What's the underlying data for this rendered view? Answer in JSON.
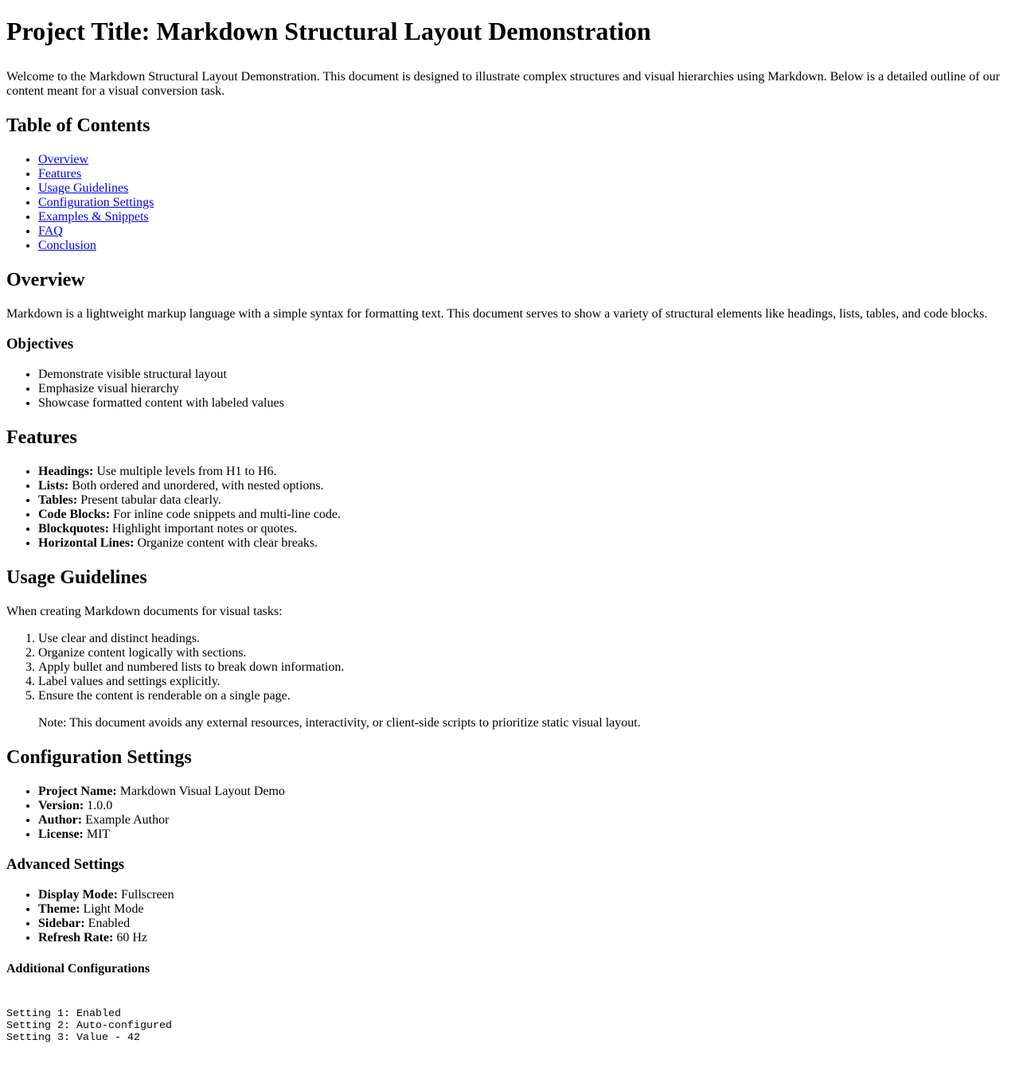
{
  "title": "Project Title: Markdown Structural Layout Demonstration",
  "intro": "Welcome to the Markdown Structural Layout Demonstration. This document is designed to illustrate complex structures and visual hierarchies using Markdown. Below is a detailed outline of our content meant for a visual conversion task.",
  "toc": {
    "heading": "Table of Contents",
    "items": [
      "Overview",
      "Features",
      "Usage Guidelines",
      "Configuration Settings",
      "Examples & Snippets",
      "FAQ",
      "Conclusion"
    ]
  },
  "overview": {
    "heading": "Overview",
    "text": "Markdown is a lightweight markup language with a simple syntax for formatting text. This document serves to show a variety of structural elements like headings, lists, tables, and code blocks.",
    "objectives_heading": "Objectives",
    "objectives": [
      "Demonstrate visible structural layout",
      "Emphasize visual hierarchy",
      "Showcase formatted content with labeled values"
    ]
  },
  "features": {
    "heading": "Features",
    "items": [
      {
        "label": "Headings:",
        "text": " Use multiple levels from H1 to H6."
      },
      {
        "label": "Lists:",
        "text": " Both ordered and unordered, with nested options."
      },
      {
        "label": "Tables:",
        "text": " Present tabular data clearly."
      },
      {
        "label": "Code Blocks:",
        "text": " For inline code snippets and multi-line code."
      },
      {
        "label": "Blockquotes:",
        "text": " Highlight important notes or quotes."
      },
      {
        "label": "Horizontal Lines:",
        "text": " Organize content with clear breaks."
      }
    ]
  },
  "usage": {
    "heading": "Usage Guidelines",
    "intro": "When creating Markdown documents for visual tasks:",
    "steps": [
      "Use clear and distinct headings.",
      "Organize content logically with sections.",
      "Apply bullet and numbered lists to break down information.",
      "Label values and settings explicitly.",
      "Ensure the content is renderable on a single page."
    ],
    "note": "Note: This document avoids any external resources, interactivity, or client-side scripts to prioritize static visual layout."
  },
  "config": {
    "heading": "Configuration Settings",
    "items": [
      {
        "label": "Project Name:",
        "text": " Markdown Visual Layout Demo"
      },
      {
        "label": "Version:",
        "text": " 1.0.0"
      },
      {
        "label": "Author:",
        "text": " Example Author"
      },
      {
        "label": "License:",
        "text": " MIT"
      }
    ],
    "advanced_heading": "Advanced Settings",
    "advanced": [
      {
        "label": "Display Mode:",
        "text": " Fullscreen"
      },
      {
        "label": "Theme:",
        "text": " Light Mode"
      },
      {
        "label": "Sidebar:",
        "text": " Enabled"
      },
      {
        "label": "Refresh Rate:",
        "text": " 60 Hz"
      }
    ],
    "additional_heading": "Additional Configurations",
    "code": "Setting 1: Enabled\nSetting 2: Auto-configured\nSetting 3: Value - 42"
  }
}
